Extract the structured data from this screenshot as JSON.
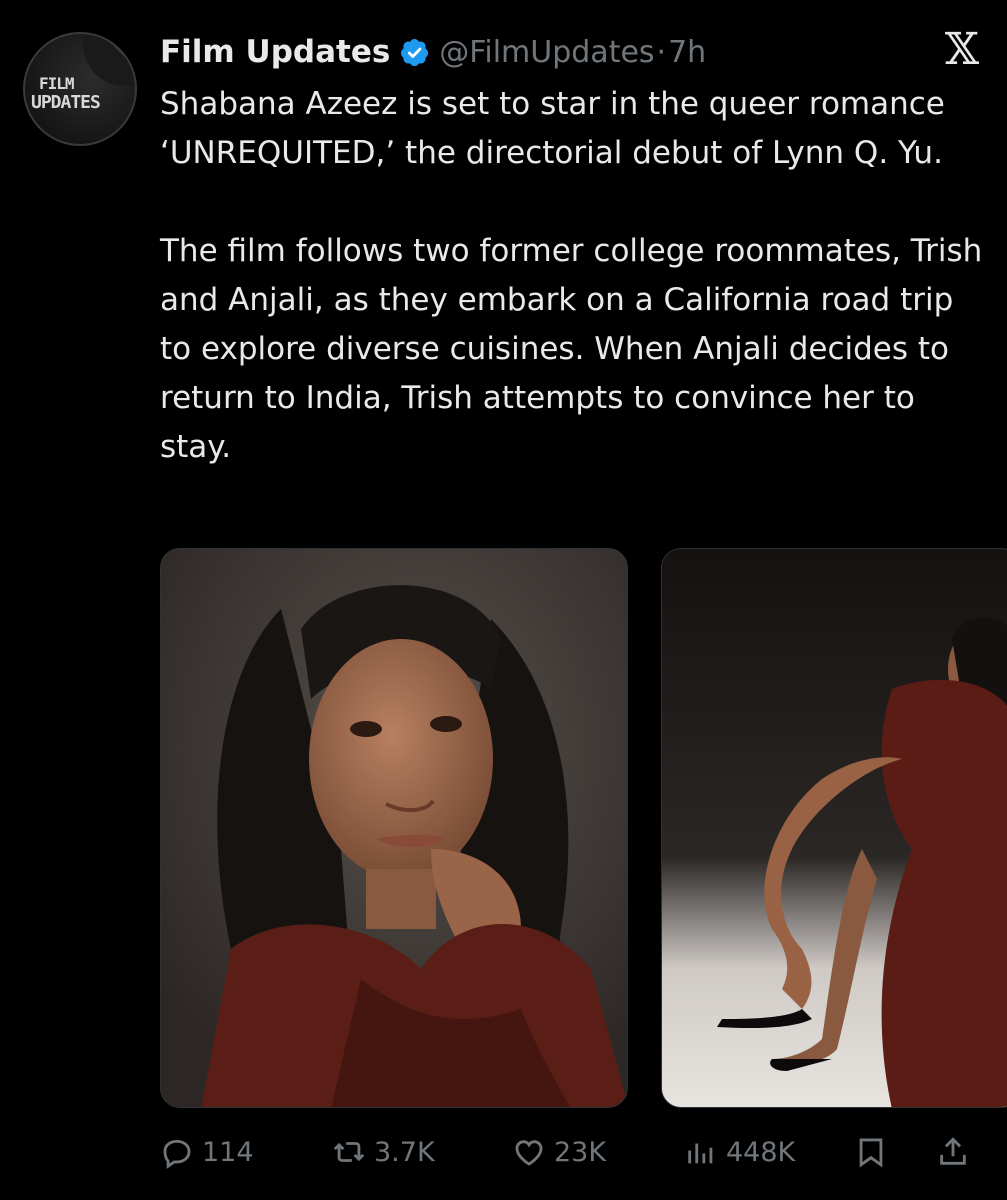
{
  "author": {
    "name": "Film Updates",
    "handle": "@FilmUpdates",
    "separator": "·",
    "time": "7h",
    "avatar_text": [
      "FILM",
      "UPDATES"
    ],
    "verified_color": "#1d9bf0"
  },
  "platform_logo": "𝕏",
  "tweet": {
    "paragraphs": [
      "Shabana Azeez is set to star in the queer romance ‘UNREQUITED,’ the directorial debut of Lynn Q. Yu.",
      "The film follows two former college roommates, Trish and Anjali, as they embark on a California road trip to explore diverse cuisines. When Anjali decides to return to India, Trish attempts to convince her to stay."
    ]
  },
  "media": [
    {
      "icon": "photo",
      "description_color": "#4a4542"
    },
    {
      "icon": "photo",
      "description_color": "#2a2624"
    }
  ],
  "actions": {
    "replies": "114",
    "reposts": "3.7K",
    "likes": "23K",
    "views": "448K"
  },
  "colors": {
    "background": "#000000",
    "text": "#e7e9ea",
    "muted": "#71767b",
    "accent": "#1d9bf0"
  }
}
